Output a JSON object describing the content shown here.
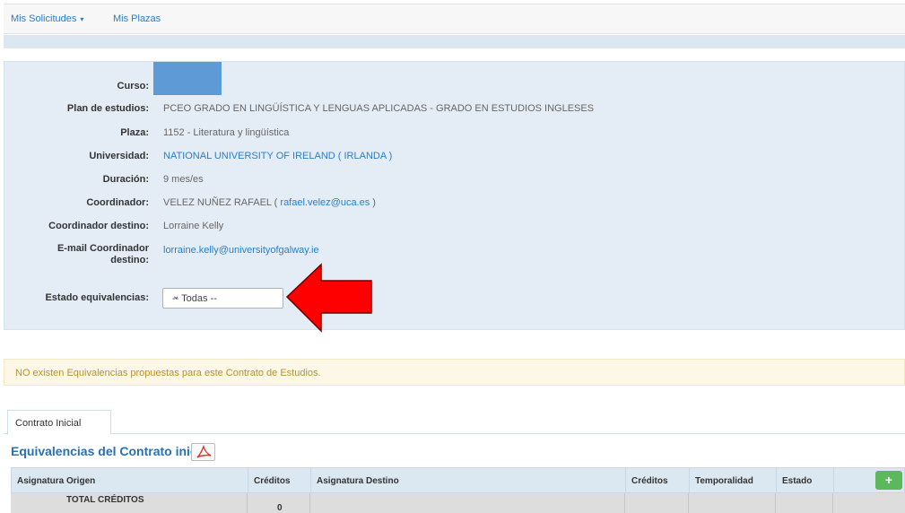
{
  "nav": {
    "solicitudes": "Mis Solicitudes",
    "plazas": "Mis Plazas"
  },
  "details": {
    "curso_label": "Curso:",
    "plan_label": "Plan de estudios:",
    "plan_value": "PCEO GRADO EN LINGÜÍSTICA Y LENGUAS APLICADAS - GRADO EN ESTUDIOS INGLESES",
    "plaza_label": "Plaza:",
    "plaza_value": "1152 - Literatura y lingüística",
    "universidad_label": "Universidad:",
    "universidad_value": "NATIONAL UNIVERSITY OF IRELAND ( IRLANDA )",
    "duracion_label": "Duración:",
    "duracion_value": "9 mes/es",
    "coordinador_label": "Coordinador:",
    "coordinador_name": "VELEZ NUÑEZ RAFAEL (",
    "coordinador_email": "rafael.velez@uca.es",
    "coordinador_close": ")",
    "coord_destino_label": "Coordinador destino:",
    "coord_destino_value": "Lorraine Kelly",
    "email_destino_label_1": "E-mail Coordinador",
    "email_destino_label_2": "destino:",
    "email_destino_value": "lorraine.kelly@universityofgalway.ie",
    "estado_label": "Estado equivalencias:",
    "estado_selected": "-- Todas --"
  },
  "alert": "NO existen Equivalencias propuestas para este Contrato de Estudios.",
  "tabs": [
    "Contrato Inicial"
  ],
  "section_title": "Equivalencias del Contrato inicial",
  "table": {
    "headers": [
      "Asignatura Origen",
      "Créditos",
      "Asignatura Destino",
      "Créditos",
      "Temporalidad",
      "Estado"
    ],
    "add_label": "+",
    "total_label": "TOTAL CRÉDITOS",
    "total_value": "0"
  },
  "colors": {
    "link": "#2a7dc9",
    "panel": "#e4edf5",
    "arrow": "#ff0000",
    "add_button": "#5cb85c",
    "alert_text": "#b7932e"
  }
}
